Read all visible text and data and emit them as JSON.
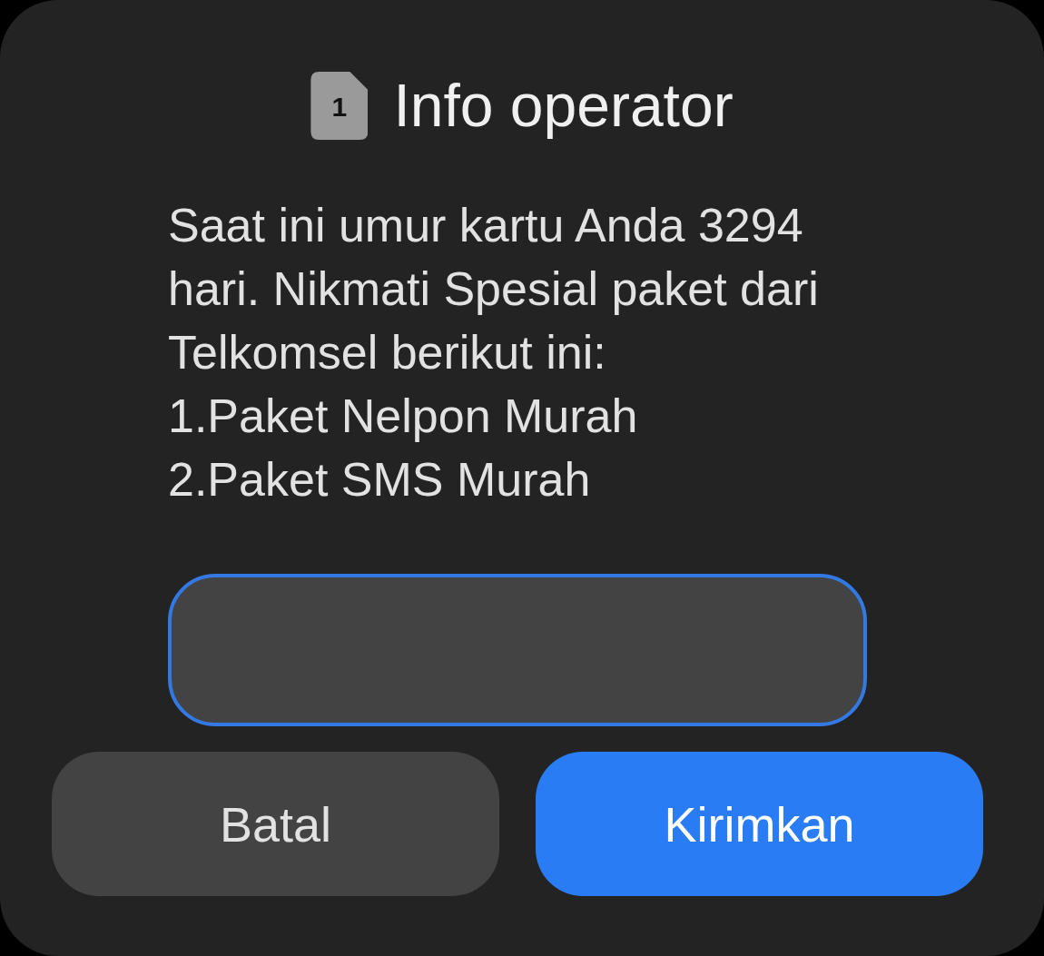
{
  "dialog": {
    "sim_slot": "1",
    "title": "Info operator",
    "message": "Saat ini umur kartu Anda 3294 hari. Nikmati Spesial paket dari Telkomsel berikut ini:\n1.Paket Nelpon Murah\n2.Paket SMS Murah"
  },
  "input": {
    "focused": true
  },
  "buttons": [
    {
      "label": "Batal",
      "kind": "secondary"
    },
    {
      "label": "Kirimkan",
      "kind": "primary"
    }
  ]
}
